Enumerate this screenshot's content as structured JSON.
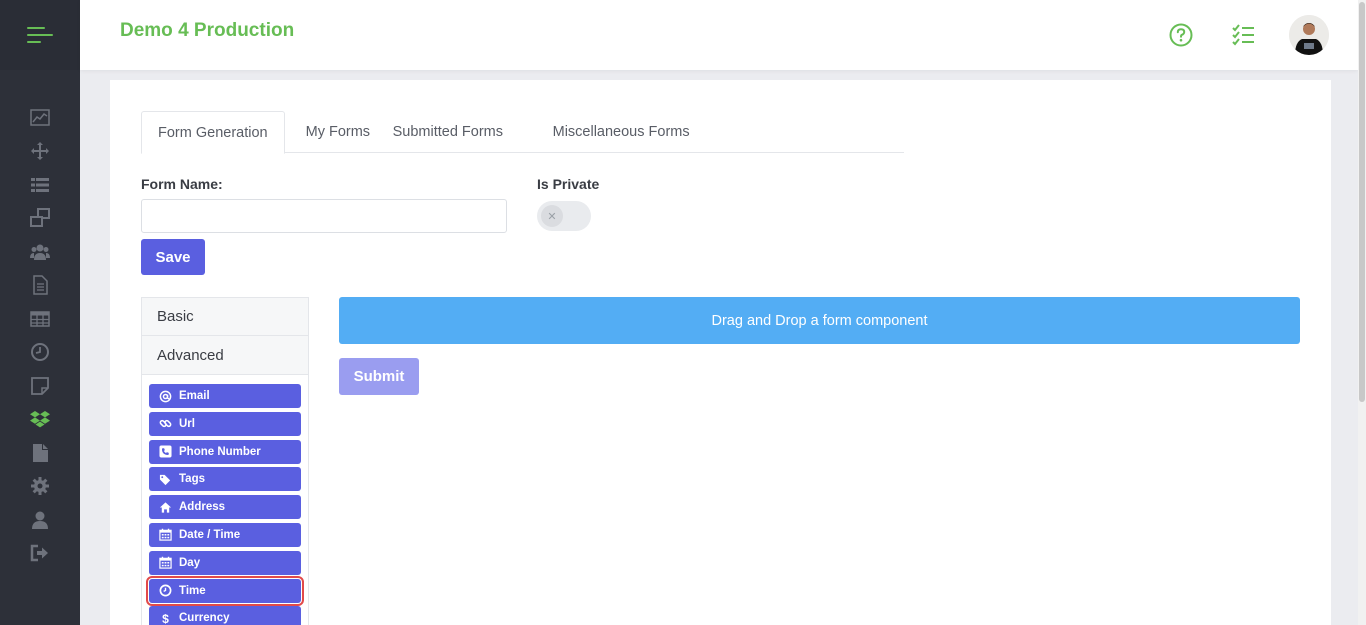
{
  "header": {
    "brand": "Demo 4 Production",
    "icons": [
      "question-circle-icon",
      "checklist-icon"
    ],
    "accent_color": "#67bd55"
  },
  "sidebar": {
    "items": [
      {
        "icon": "chart-line-icon"
      },
      {
        "icon": "move-arrows-icon"
      },
      {
        "icon": "list-icon"
      },
      {
        "icon": "windows-icon"
      },
      {
        "icon": "users-icon"
      },
      {
        "icon": "document-icon"
      },
      {
        "icon": "table-icon"
      },
      {
        "icon": "clock-icon"
      },
      {
        "icon": "note-icon"
      },
      {
        "icon": "dropbox-icon",
        "active": true
      },
      {
        "icon": "file-icon"
      },
      {
        "icon": "gear-icon"
      },
      {
        "icon": "user-icon"
      },
      {
        "icon": "sign-out-icon"
      }
    ]
  },
  "tabs": [
    {
      "label": "Form Generation",
      "active": true
    },
    {
      "label": "My Forms"
    },
    {
      "label": "Submitted Forms"
    },
    {
      "label": "Miscellaneous Forms"
    }
  ],
  "form": {
    "name_label": "Form Name:",
    "name_value": "",
    "private_label": "Is Private",
    "private_on": false,
    "save_label": "Save"
  },
  "builder": {
    "sections": [
      "Basic",
      "Advanced"
    ],
    "components": [
      {
        "label": "Email",
        "icon": "at-icon"
      },
      {
        "label": "Url",
        "icon": "link-icon"
      },
      {
        "label": "Phone Number",
        "icon": "phone-icon"
      },
      {
        "label": "Tags",
        "icon": "tags-icon"
      },
      {
        "label": "Address",
        "icon": "home-icon"
      },
      {
        "label": "Date / Time",
        "icon": "calendar-icon"
      },
      {
        "label": "Day",
        "icon": "calendar-icon"
      },
      {
        "label": "Time",
        "icon": "clock-icon",
        "highlighted": true
      },
      {
        "label": "Currency",
        "icon": "dollar-icon"
      }
    ],
    "dropzone_text": "Drag and Drop a form component",
    "submit_label": "Submit"
  }
}
